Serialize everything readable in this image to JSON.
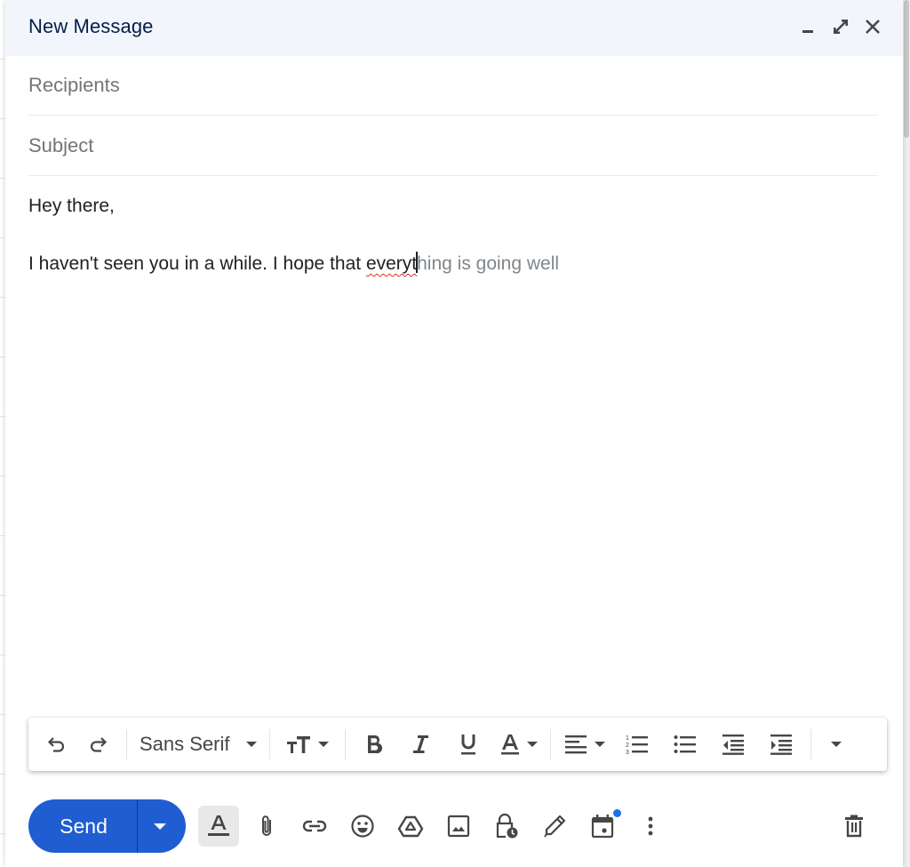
{
  "compose": {
    "title": "New Message",
    "header_actions": [
      {
        "name": "minimize",
        "icon": "minimize-icon"
      },
      {
        "name": "full-screen",
        "icon": "expand-icon"
      },
      {
        "name": "close",
        "icon": "close-icon"
      }
    ],
    "recipients": {
      "value": "",
      "placeholder": "Recipients"
    },
    "subject": {
      "value": "",
      "placeholder": "Subject"
    },
    "body": {
      "greeting": "Hey there,",
      "line_typed_before_misspell": "I haven't seen you in a while. I hope that ",
      "misspelled_word": "everyt",
      "autocomplete_suggestion": "hing is going well"
    }
  },
  "formatting_toolbar": {
    "font": "Sans Serif",
    "buttons": [
      "undo",
      "redo",
      "font",
      "size",
      "bold",
      "italic",
      "underline",
      "text-color",
      "align",
      "numbered-list",
      "bulleted-list",
      "indent-less",
      "indent-more",
      "more-formatting"
    ]
  },
  "bottom_bar": {
    "send_label": "Send",
    "tools": [
      "formatting-options",
      "attach-files",
      "insert-link",
      "insert-emoji",
      "insert-drive-files",
      "insert-photo",
      "confidential-mode",
      "insert-signature",
      "set-up-time-to-meet",
      "more-options"
    ],
    "calendar_badge": true,
    "discard": "discard-draft"
  },
  "colors": {
    "header_bg": "#f2f6fc",
    "title": "#041e49",
    "send": "#1f5dd1",
    "badge": "#1f6fe8",
    "spell_error": "#d93025"
  }
}
